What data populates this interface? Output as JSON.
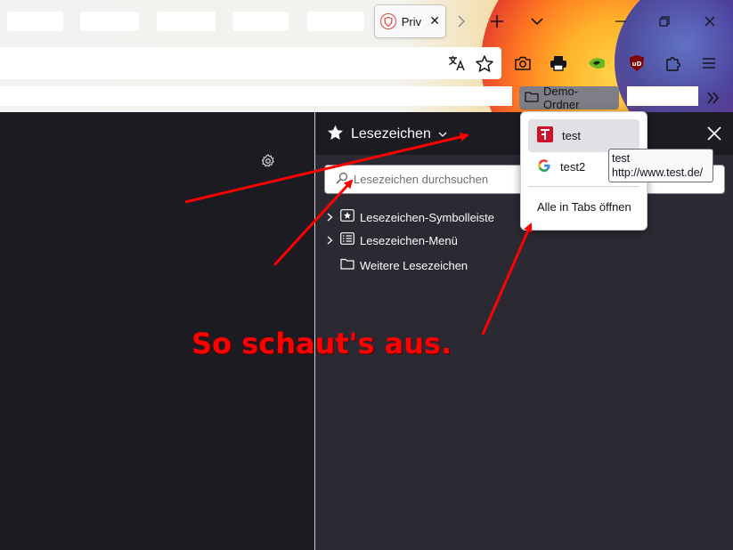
{
  "tabs": {
    "active_title": "Priv",
    "close_glyph": "✕"
  },
  "bookmarks_toolbar": {
    "folder_label": "Demo-Ordner"
  },
  "sidebar": {
    "title": "Lesezeichen",
    "search_placeholder": "Lesezeichen durchsuchen",
    "tree": [
      {
        "label": "Lesezeichen-Symbolleiste",
        "icon": "bookmark-toolbar-icon",
        "expandable": true
      },
      {
        "label": "Lesezeichen-Menü",
        "icon": "bookmark-menu-icon",
        "expandable": true
      },
      {
        "label": "Weitere Lesezeichen",
        "icon": "folder-icon",
        "expandable": false
      }
    ]
  },
  "popup": {
    "items": [
      {
        "label": "test",
        "icon": "test-site-favicon"
      },
      {
        "label": "test2",
        "icon": "google-favicon"
      }
    ],
    "open_all": "Alle in Tabs öffnen"
  },
  "tooltip": {
    "line1": "test",
    "line2": "http://www.test.de/"
  },
  "annotation": {
    "text": "So schaut's aus."
  },
  "colors": {
    "annotation": "#ff0000",
    "sidebar_bg": "#2b2a33",
    "content_bg": "#1c1b22",
    "popup_hover": "#e0e0e6"
  }
}
